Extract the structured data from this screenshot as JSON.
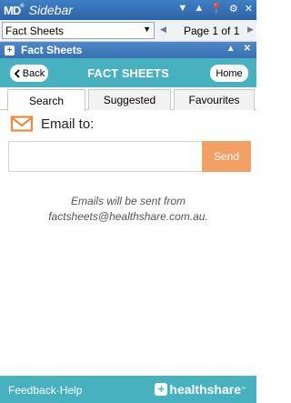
{
  "window": {
    "logo": "MD",
    "title": "Sidebar",
    "controls": [
      "▼",
      "▲",
      "📌",
      "⚙",
      "✕"
    ]
  },
  "toolbar": {
    "selected": "Fact Sheets",
    "page": "Page 1 of 1"
  },
  "panel": {
    "title": "Fact Sheets",
    "controls": [
      "▲",
      "✕"
    ]
  },
  "header": {
    "back": "Back",
    "title": "FACT SHEETS",
    "home": "Home"
  },
  "tabs": [
    "Search",
    "Suggested",
    "Favourites"
  ],
  "email": {
    "label": "Email to:",
    "send": "Send",
    "note_line1": "Emails will be sent from",
    "note_line2": "factsheets@healthshare.com.au."
  },
  "footer": {
    "feedback": "Feedback",
    "separator": "·",
    "help": "Help",
    "brand": "healthshare"
  },
  "colors": {
    "teal": "#48b1bf",
    "send": "#f2a064",
    "titlebar": "#2d64a8"
  }
}
